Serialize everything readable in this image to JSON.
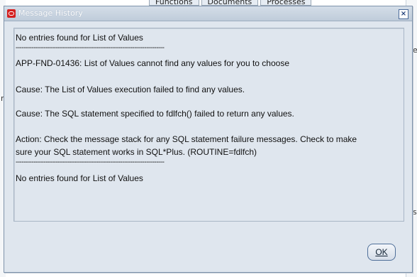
{
  "background": {
    "tabs": [
      "Functions",
      "Documents",
      "Processes"
    ],
    "left_char": "r",
    "right_chars": [
      "e",
      "s"
    ]
  },
  "dialog": {
    "title": "Message History",
    "close_label": "×",
    "messages": [
      "No entries found for List of Values",
      "--------------------------------------------------------------------------",
      "APP-FND-01436: List of Values cannot find any values for you to choose",
      "",
      "Cause: The List of Values execution failed to find any values.",
      "",
      "Cause: The SQL statement specified to fdlfch() failed to return any values.",
      "",
      "Action: Check the message stack for any SQL statement failure messages. Check to make",
      "sure your SQL statement works in SQL*Plus. (ROUTINE=fdlfch)",
      "--------------------------------------------------------------------------",
      "No entries found for List of Values"
    ],
    "ok_label": "OK"
  },
  "colors": {
    "dialog_bg": "#dfe6ee",
    "oracle_red": "#d42020",
    "title_text": "#ffffff"
  }
}
